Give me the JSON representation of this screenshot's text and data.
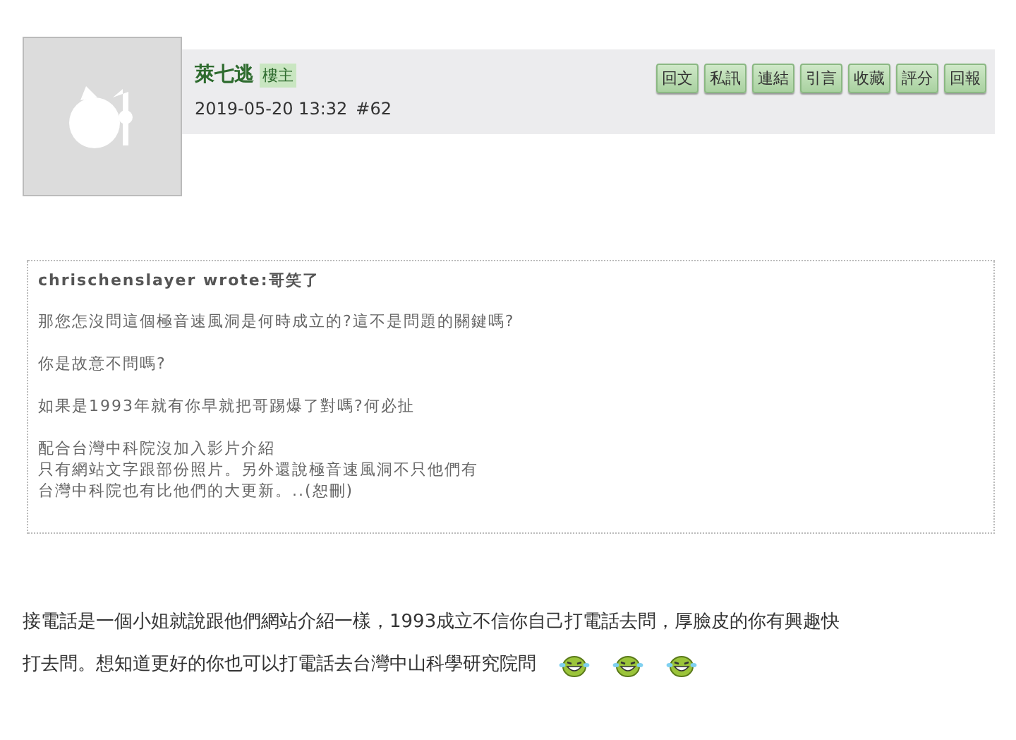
{
  "post": {
    "author": "萊七逃",
    "badge": "樓主",
    "timestamp": "2019-05-20 13:32",
    "floor": "#62",
    "buttons": [
      "回文",
      "私訊",
      "連結",
      "引言",
      "收藏",
      "評分",
      "回報"
    ]
  },
  "quote": {
    "header": "chrischenslayer wrote:哥笑了",
    "paragraphs": [
      [
        "那您怎沒問這個極音速風洞是何時成立的?這不是問題的關鍵嗎?"
      ],
      [
        "你是故意不問嗎?"
      ],
      [
        "如果是1993年就有你早就把哥踢爆了對嗎?何必扯"
      ],
      [
        "配合台灣中科院沒加入影片介紹",
        "只有網站文字跟部份照片。另外還說極音速風洞不只他們有",
        "台灣中科院也有比他們的大更新。..(恕刪)"
      ]
    ]
  },
  "body": {
    "lines": [
      "接電話是一個小姐就說跟他們網站介紹一樣，1993成立不信你自己打電話去問，厚臉皮的你有興趣快",
      "打去問。想知道更好的你也可以打電話去台灣中山科學研究院問"
    ],
    "emoticons": [
      {
        "kind": "laugh"
      },
      {
        "kind": "laugh"
      },
      {
        "kind": "laugh"
      }
    ]
  }
}
